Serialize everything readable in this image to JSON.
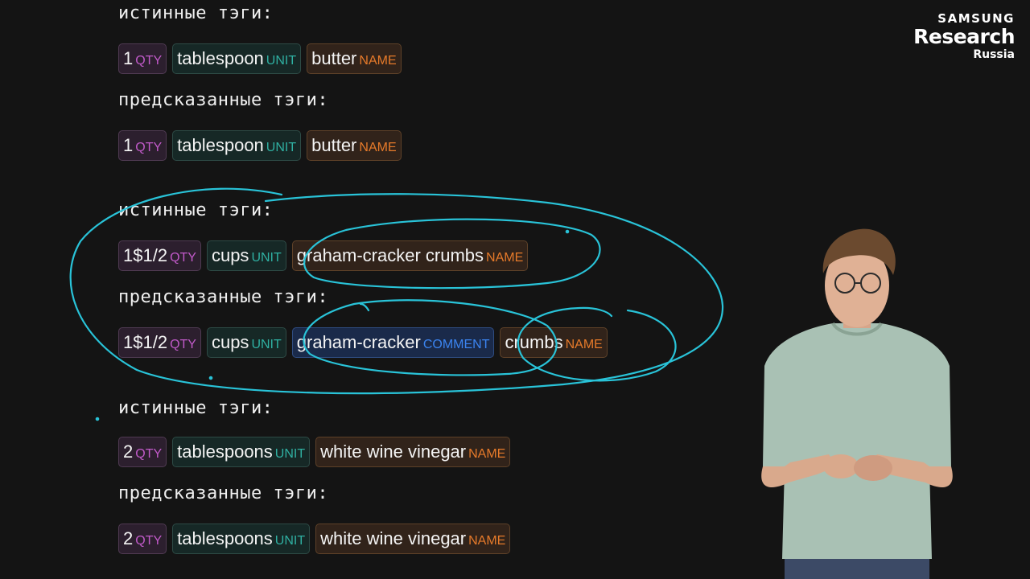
{
  "logo": {
    "brand": "SAMSUNG",
    "name": "Research",
    "region": "Russia"
  },
  "colors": {
    "background": "#141414",
    "qty": "#c15ac9",
    "unit": "#2fb0a2",
    "name": "#e67a2a",
    "comment": "#3b84f0",
    "annotation_ink": "#29c3d8"
  },
  "blocks": [
    {
      "true_heading": "истинные тэги:",
      "true_tags": [
        {
          "text": "1",
          "tag": "QTY"
        },
        {
          "text": "tablespoon",
          "tag": "UNIT"
        },
        {
          "text": "butter",
          "tag": "NAME"
        }
      ],
      "pred_heading": "предсказанные тэги:",
      "pred_tags": [
        {
          "text": "1",
          "tag": "QTY"
        },
        {
          "text": "tablespoon",
          "tag": "UNIT"
        },
        {
          "text": "butter",
          "tag": "NAME"
        }
      ]
    },
    {
      "true_heading": "истинные тэги:",
      "true_tags": [
        {
          "text": "1$1/2",
          "tag": "QTY"
        },
        {
          "text": "cups",
          "tag": "UNIT"
        },
        {
          "text": "graham-cracker crumbs",
          "tag": "NAME"
        }
      ],
      "pred_heading": "предсказанные тэги:",
      "pred_tags": [
        {
          "text": "1$1/2",
          "tag": "QTY"
        },
        {
          "text": "cups",
          "tag": "UNIT"
        },
        {
          "text": "graham-cracker",
          "tag": "COMMENT"
        },
        {
          "text": "crumbs",
          "tag": "NAME"
        }
      ]
    },
    {
      "true_heading": "истинные тэги:",
      "true_tags": [
        {
          "text": "2",
          "tag": "QTY"
        },
        {
          "text": "tablespoons",
          "tag": "UNIT"
        },
        {
          "text": "white wine vinegar",
          "tag": "NAME"
        }
      ],
      "pred_heading": "предсказанные тэги:",
      "pred_tags": [
        {
          "text": "2",
          "tag": "QTY"
        },
        {
          "text": "tablespoons",
          "tag": "UNIT"
        },
        {
          "text": "white wine vinegar",
          "tag": "NAME"
        }
      ]
    }
  ]
}
